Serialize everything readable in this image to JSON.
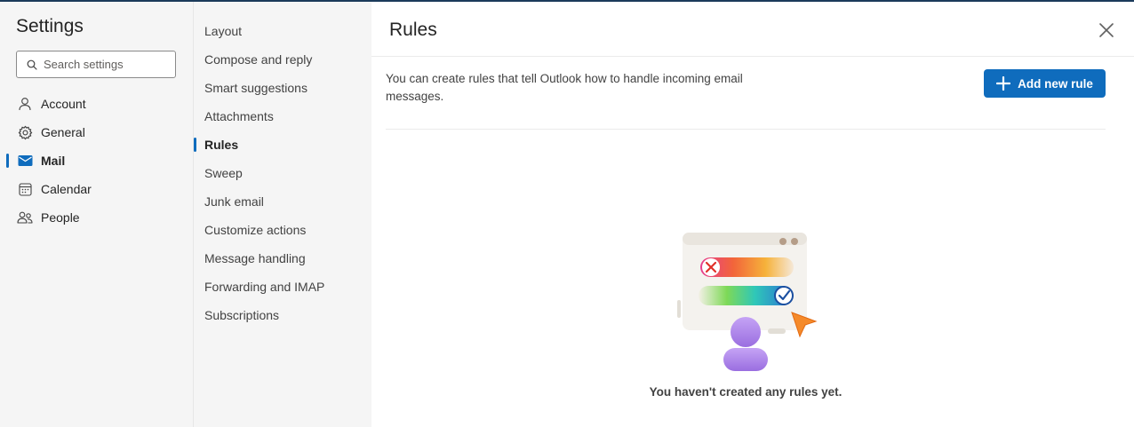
{
  "settings": {
    "title": "Settings",
    "search_placeholder": "Search settings",
    "categories": [
      {
        "label": "Account",
        "icon": "person-icon"
      },
      {
        "label": "General",
        "icon": "gear-icon"
      },
      {
        "label": "Mail",
        "icon": "mail-icon",
        "active": true
      },
      {
        "label": "Calendar",
        "icon": "calendar-icon"
      },
      {
        "label": "People",
        "icon": "people-icon"
      }
    ]
  },
  "mail_sections": [
    {
      "label": "Layout"
    },
    {
      "label": "Compose and reply"
    },
    {
      "label": "Smart suggestions"
    },
    {
      "label": "Attachments"
    },
    {
      "label": "Rules",
      "active": true
    },
    {
      "label": "Sweep"
    },
    {
      "label": "Junk email"
    },
    {
      "label": "Customize actions"
    },
    {
      "label": "Message handling"
    },
    {
      "label": "Forwarding and IMAP"
    },
    {
      "label": "Subscriptions"
    }
  ],
  "main": {
    "title": "Rules",
    "description": "You can create rules that tell Outlook how to handle incoming email messages.",
    "add_button_label": "Add new rule",
    "empty_state_text": "You haven't created any rules yet."
  },
  "colors": {
    "accent": "#0f6cbd",
    "pane_background": "#f5f5f5"
  }
}
